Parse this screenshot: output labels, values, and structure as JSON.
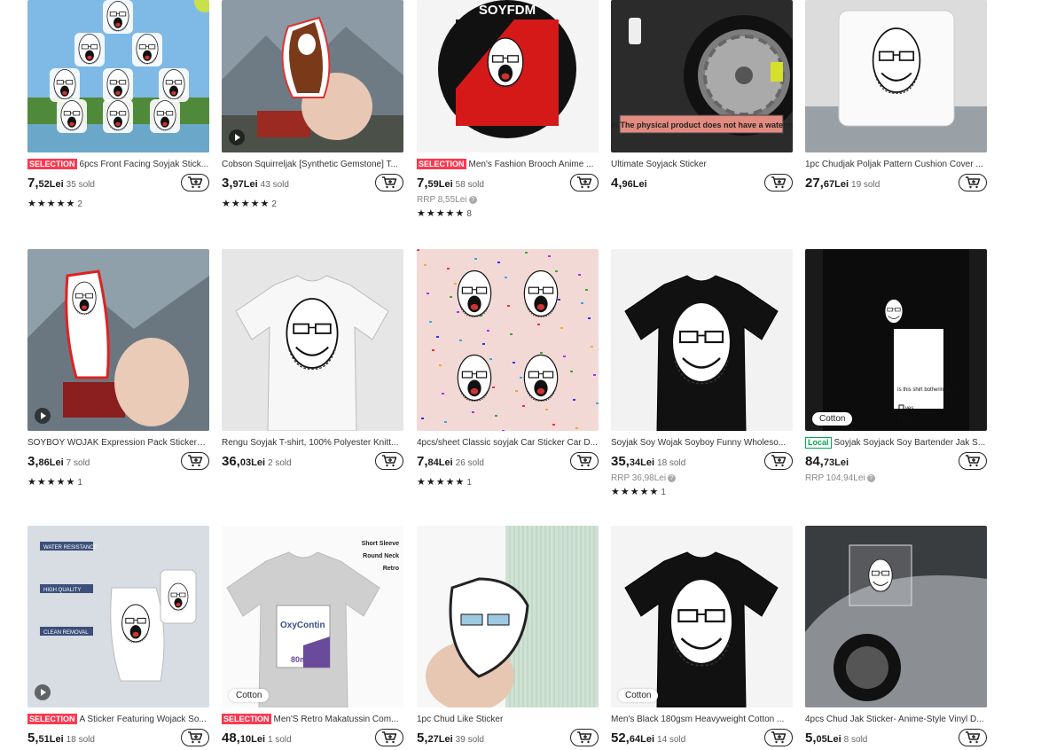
{
  "products": [
    {
      "title": "6pcs Front Facing Soyjak Stick...",
      "selection": true,
      "local": false,
      "price_int": "7,",
      "price_dec": "52",
      "currency": "Lei",
      "sold": "35 sold",
      "rrp": "",
      "stars": "★★★★★",
      "reviews": "2",
      "badge": "",
      "video": false,
      "art": "stickers-grid"
    },
    {
      "title": "Cobson Squirreljak [Synthetic Gemstone] T...",
      "selection": false,
      "local": false,
      "price_int": "3,",
      "price_dec": "97",
      "currency": "Lei",
      "sold": "43 sold",
      "rrp": "",
      "stars": "★★★★★",
      "reviews": "2",
      "badge": "",
      "video": true,
      "art": "squirrel"
    },
    {
      "title": "Men's Fashion Brooch Anime ...",
      "selection": true,
      "local": false,
      "price_int": "7,",
      "price_dec": "59",
      "currency": "Lei",
      "sold": "58 sold",
      "rrp": "RRP 8,55Lei",
      "stars": "★★★★★",
      "reviews": "8",
      "badge": "",
      "video": false,
      "art": "brooch",
      "brooch_text": "SOYFDM"
    },
    {
      "title": "Ultimate Soyjack Sticker",
      "selection": false,
      "local": false,
      "price_int": "4,",
      "price_dec": "96",
      "currency": "Lei",
      "sold": "",
      "rrp": "",
      "stars": "",
      "reviews": "",
      "badge": "",
      "video": false,
      "art": "car-wheel",
      "note": "Note: The physical product does not have a watermark"
    },
    {
      "title": "1pc Chudjak Poljak Pattern Cushion Cover ...",
      "selection": false,
      "local": false,
      "price_int": "27,",
      "price_dec": "67",
      "currency": "Lei",
      "sold": "19 sold",
      "rrp": "",
      "stars": "",
      "reviews": "",
      "badge": "",
      "video": false,
      "art": "cushion"
    },
    {
      "title": "SOYBOY WOJAK Expression Pack Stickers - ...",
      "selection": false,
      "local": false,
      "price_int": "3,",
      "price_dec": "86",
      "currency": "Lei",
      "sold": "7 sold",
      "rrp": "",
      "stars": "★★★★★",
      "reviews": "1",
      "badge": "",
      "video": true,
      "art": "hand-sticker"
    },
    {
      "title": "Rengu Soyjak T-shirt, 100% Polyester Knitt...",
      "selection": false,
      "local": false,
      "price_int": "36,",
      "price_dec": "03",
      "currency": "Lei",
      "sold": "2 sold",
      "rrp": "",
      "stars": "",
      "reviews": "",
      "badge": "",
      "video": false,
      "art": "white-tee"
    },
    {
      "title": "4pcs/sheet Classic soyjak Car Sticker Car D...",
      "selection": false,
      "local": false,
      "price_int": "7,",
      "price_dec": "84",
      "currency": "Lei",
      "sold": "26 sold",
      "rrp": "",
      "stars": "★★★★★",
      "reviews": "1",
      "badge": "",
      "video": false,
      "art": "pink-sheet"
    },
    {
      "title": "Soyjak Soy Wojak Soyboy Funny Wholeso...",
      "selection": false,
      "local": false,
      "price_int": "35,",
      "price_dec": "34",
      "currency": "Lei",
      "sold": "18 sold",
      "rrp": "RRP 36,98Lei",
      "stars": "★★★★★",
      "reviews": "1",
      "badge": "",
      "video": false,
      "art": "black-tee"
    },
    {
      "title": "Soyjak Soyjack Soy Bartender Jak S...",
      "selection": false,
      "local": true,
      "local_label": "Local",
      "price_int": "84,",
      "price_dec": "73",
      "currency": "Lei",
      "sold": "",
      "rrp": "RRP 104,94Lei",
      "stars": "",
      "reviews": "",
      "badge": "Cotton",
      "video": false,
      "art": "bartender-tee",
      "tee_text": "Is this shirt bothering you?",
      "opt_yes": "yes",
      "opt_no": "no"
    },
    {
      "title": "A Sticker Featuring Wojack So...",
      "selection": true,
      "local": false,
      "price_int": "5,",
      "price_dec": "51",
      "currency": "Lei",
      "sold": "18 sold",
      "rrp": "",
      "stars": "",
      "reviews": "",
      "badge": "",
      "video": true,
      "art": "info-sticker",
      "info": [
        "WATER RESISTANCE",
        "HIGH QUALITY",
        "CLEAN REMOVAL"
      ]
    },
    {
      "title": "Men'S Retro Makatussin Com...",
      "selection": true,
      "local": false,
      "price_int": "48,",
      "price_dec": "10",
      "currency": "Lei",
      "sold": "1 sold",
      "rrp": "",
      "stars": "",
      "reviews": "",
      "badge": "Cotton",
      "video": false,
      "art": "oxy-tee",
      "tee_labels": [
        "Short Sleeve",
        "Round Neck",
        "Retro"
      ],
      "brand": "OxyContin",
      "dose": "80mg"
    },
    {
      "title": "1pc Chud Like Sticker",
      "selection": false,
      "local": false,
      "price_int": "5,",
      "price_dec": "27",
      "currency": "Lei",
      "sold": "39 sold",
      "rrp": "",
      "stars": "",
      "reviews": "",
      "badge": "",
      "video": false,
      "art": "chud-sticker"
    },
    {
      "title": "Men's Black 180gsm Heavyweight Cotton ...",
      "selection": false,
      "local": false,
      "price_int": "52,",
      "price_dec": "64",
      "currency": "Lei",
      "sold": "14 sold",
      "rrp": "",
      "stars": "",
      "reviews": "",
      "badge": "Cotton",
      "video": false,
      "art": "black-tee2"
    },
    {
      "title": "4pcs Chud Jak Sticker- Anime-Style Vinyl D...",
      "selection": false,
      "local": false,
      "price_int": "5,",
      "price_dec": "05",
      "currency": "Lei",
      "sold": "8 sold",
      "rrp": "",
      "stars": "",
      "reviews": "",
      "badge": "",
      "video": false,
      "art": "car-rear"
    }
  ],
  "labels": {
    "selection": "SELECTION",
    "rrp_help": "?"
  }
}
